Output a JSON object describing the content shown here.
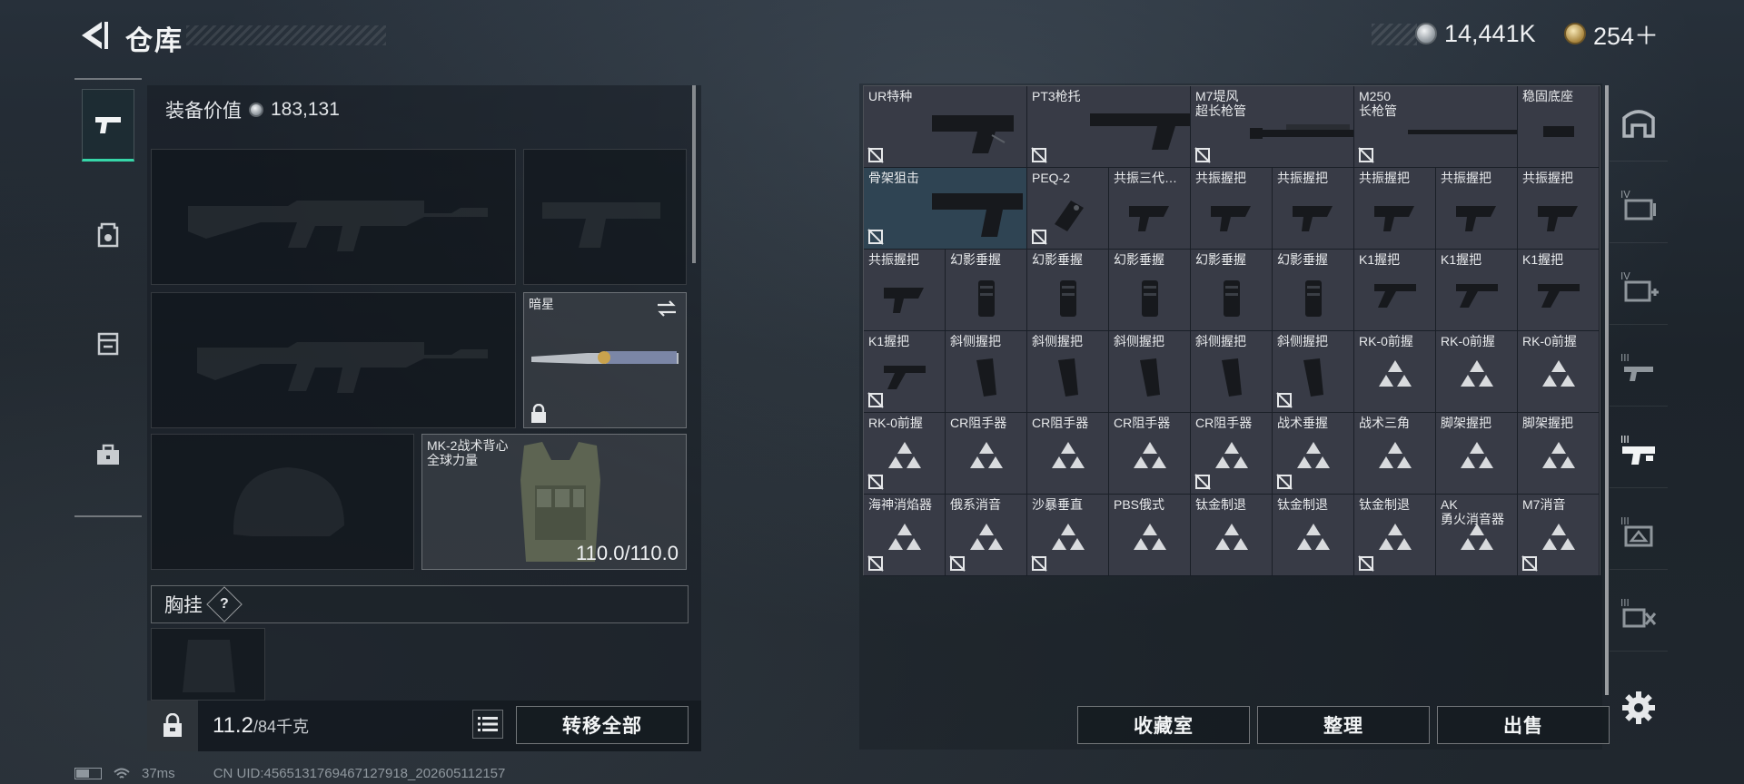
{
  "header": {
    "title": "仓库",
    "currency_silver": "14,441K",
    "currency_gold": "254＋"
  },
  "loadout": {
    "equipment_value_label": "装备价值",
    "equipment_value": "183,131",
    "knife_label": "暗星",
    "vest_label": "MK-2战术背心\n全球力量",
    "vest_durability": "110.0/110.0",
    "chest_rig_label": "胸挂",
    "help_glyph": "?"
  },
  "footer": {
    "weight": "11.2",
    "weight_cap": "/84千克",
    "transfer_all": "转移全部",
    "collection": "收藏室",
    "organize": "整理",
    "sell": "出售"
  },
  "status": {
    "ping": "37ms",
    "uid": "CN UID:456513176946712791​8_202605112157"
  },
  "grid_items": [
    {
      "name": "UR特种",
      "kind": "stock",
      "tag": true
    },
    {
      "name": "PT3枪托",
      "kind": "stock2",
      "tag": true
    },
    {
      "name": "M7堤风\n超长枪管",
      "kind": "barrel",
      "tag": true
    },
    {
      "name": "M250\n长枪管",
      "kind": "barrel2",
      "tag": true
    },
    {
      "name": "稳固底座",
      "kind": "small",
      "tag": false
    },
    {
      "name": "骨架狙击",
      "kind": "stock3",
      "tag": true
    },
    {
      "name": "PEQ-2",
      "kind": "laser",
      "tag": true
    },
    {
      "name": "共振三代…",
      "kind": "grip",
      "tag": false
    },
    {
      "name": "共振握把",
      "kind": "grip",
      "tag": false
    },
    {
      "name": "共振握把",
      "kind": "grip",
      "tag": false
    },
    {
      "name": "共振握把",
      "kind": "grip",
      "tag": false
    },
    {
      "name": "共振握把",
      "kind": "grip",
      "tag": false
    },
    {
      "name": "共振握把",
      "kind": "grip",
      "tag": false
    },
    {
      "name": "共振握把",
      "kind": "grip",
      "tag": false
    },
    {
      "name": "幻影垂握",
      "kind": "vgrip",
      "tag": false
    },
    {
      "name": "幻影垂握",
      "kind": "vgrip",
      "tag": false
    },
    {
      "name": "幻影垂握",
      "kind": "vgrip",
      "tag": false
    },
    {
      "name": "幻影垂握",
      "kind": "vgrip",
      "tag": false
    },
    {
      "name": "幻影垂握",
      "kind": "vgrip",
      "tag": false
    },
    {
      "name": "K1握把",
      "kind": "k1",
      "tag": false
    },
    {
      "name": "K1握把",
      "kind": "k1",
      "tag": false
    },
    {
      "name": "K1握把",
      "kind": "k1",
      "tag": false
    },
    {
      "name": "K1握把",
      "kind": "k1",
      "tag": true
    },
    {
      "name": "斜侧握把",
      "kind": "agrip",
      "tag": false
    },
    {
      "name": "斜侧握把",
      "kind": "agrip",
      "tag": false
    },
    {
      "name": "斜侧握把",
      "kind": "agrip",
      "tag": false
    },
    {
      "name": "斜侧握把",
      "kind": "agrip",
      "tag": false
    },
    {
      "name": "斜侧握把",
      "kind": "agrip",
      "tag": true
    },
    {
      "name": "RK-0前握",
      "kind": "tri",
      "tag": false
    },
    {
      "name": "RK-0前握",
      "kind": "tri",
      "tag": false
    },
    {
      "name": "RK-0前握",
      "kind": "tri",
      "tag": false
    },
    {
      "name": "RK-0前握",
      "kind": "tri",
      "tag": true
    },
    {
      "name": "CR阻手器",
      "kind": "tri",
      "tag": false
    },
    {
      "name": "CR阻手器",
      "kind": "tri",
      "tag": false
    },
    {
      "name": "CR阻手器",
      "kind": "tri",
      "tag": false
    },
    {
      "name": "CR阻手器",
      "kind": "tri",
      "tag": true
    },
    {
      "name": "战术垂握",
      "kind": "tri",
      "tag": true
    },
    {
      "name": "战术三角",
      "kind": "tri",
      "tag": false
    },
    {
      "name": "脚架握把",
      "kind": "tri",
      "tag": false
    },
    {
      "name": "脚架握把",
      "kind": "tri",
      "tag": false
    },
    {
      "name": "海神消焰器",
      "kind": "tri",
      "tag": true
    },
    {
      "name": "俄系消音",
      "kind": "tri",
      "tag": true
    },
    {
      "name": "沙暴垂直",
      "kind": "tri",
      "tag": true
    },
    {
      "name": "PBS俄式",
      "kind": "tri",
      "tag": false
    },
    {
      "name": "钛金制退",
      "kind": "tri",
      "tag": false
    },
    {
      "name": "钛金制退",
      "kind": "tri",
      "tag": false
    },
    {
      "name": "钛金制退",
      "kind": "tri",
      "tag": true
    },
    {
      "name": "AK\n勇火消音器",
      "kind": "tri",
      "tag": false
    },
    {
      "name": "M7消音",
      "kind": "tri",
      "tag": true
    }
  ]
}
